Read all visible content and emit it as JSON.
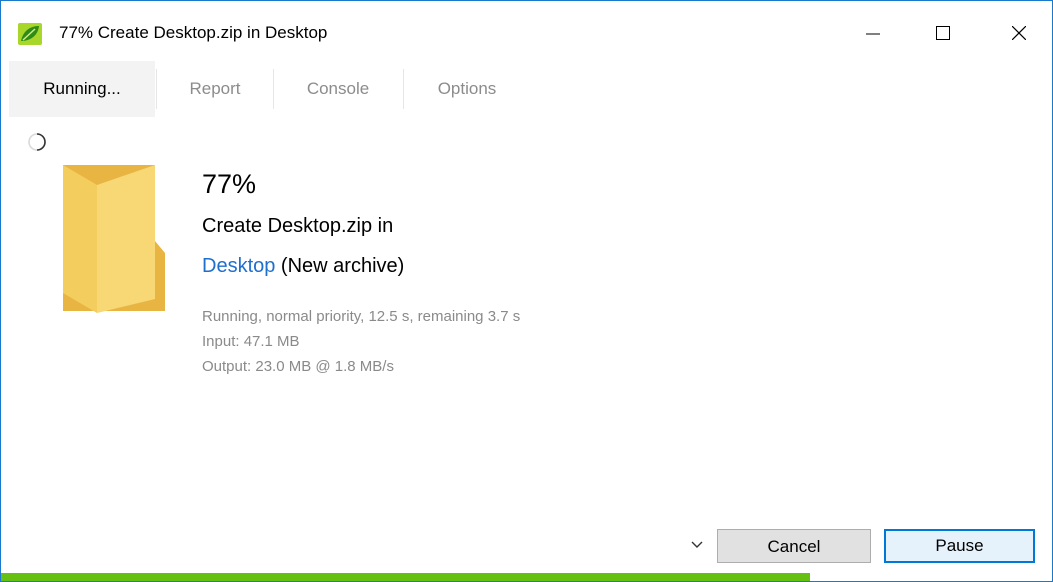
{
  "window": {
    "title": "77% Create Desktop.zip in Desktop",
    "app_icon": "peazip-leaf-icon",
    "controls": {
      "minimize": "minimize-icon",
      "maximize": "maximize-icon",
      "close": "close-icon"
    }
  },
  "tabs": [
    {
      "label": "Running...",
      "active": true
    },
    {
      "label": "Report",
      "active": false
    },
    {
      "label": "Console",
      "active": false
    },
    {
      "label": "Options",
      "active": false
    }
  ],
  "job": {
    "percent_text": "77%",
    "progress": 0.77,
    "action_text": "Create Desktop.zip in",
    "destination_link": "Desktop",
    "destination_suffix": " (New archive)",
    "status_line": "Running, normal priority, 12.5 s, remaining 3.7 s",
    "input_line": "Input: 47.1 MB",
    "output_line": "Output: 23.0 MB @ 1.8 MB/s"
  },
  "buttons": {
    "cancel": "Cancel",
    "pause": "Pause"
  },
  "colors": {
    "accent": "#0078d7",
    "progress": "#66c011",
    "link": "#1f6fcf",
    "window_border": "#1979ca"
  }
}
